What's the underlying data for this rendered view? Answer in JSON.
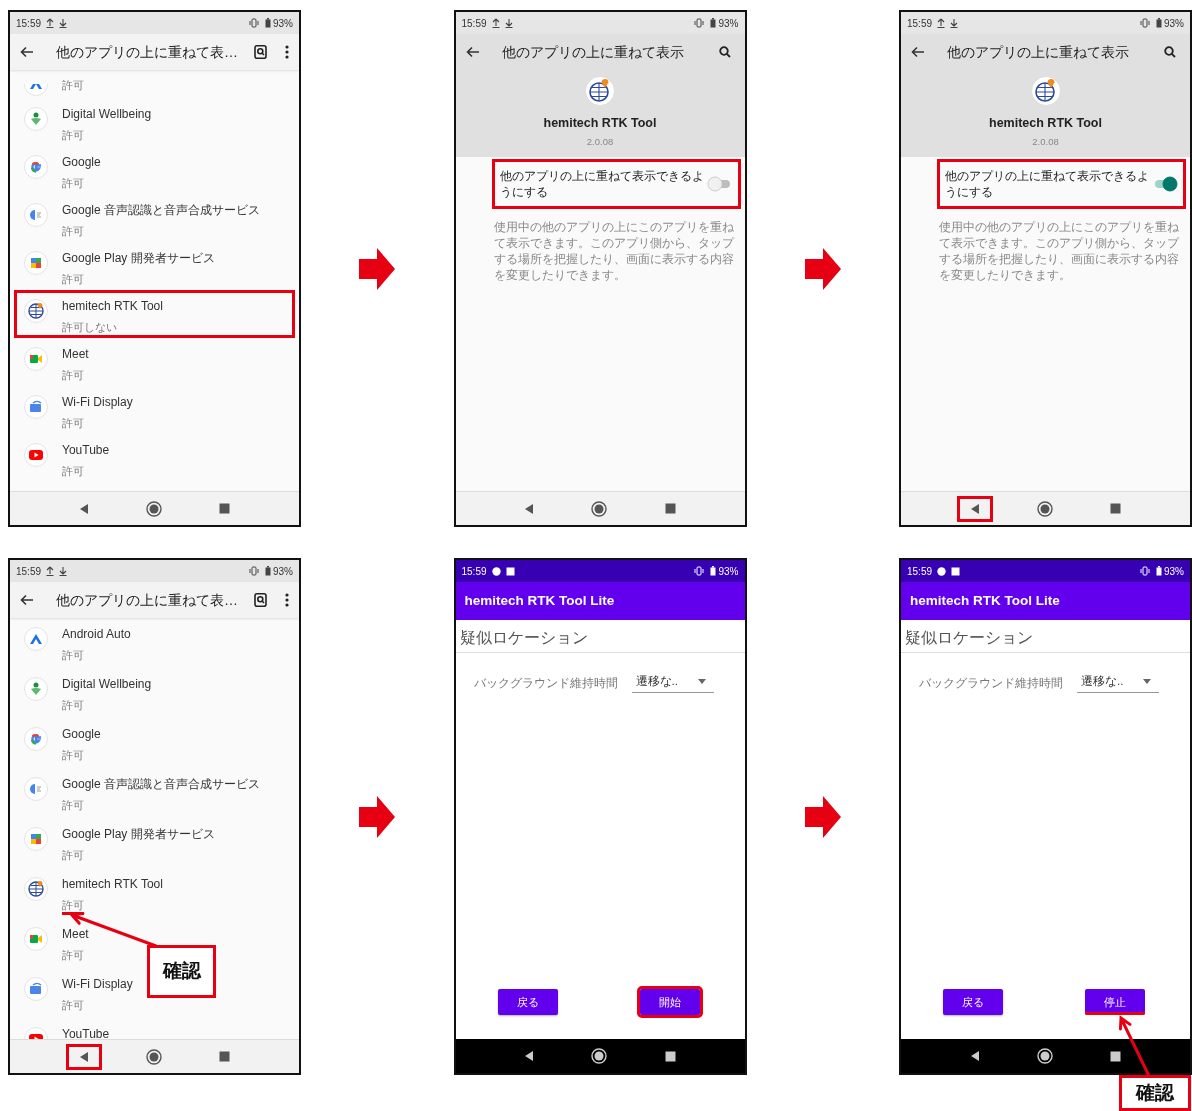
{
  "panels": [
    {
      "kind": "list",
      "status_bar": {
        "time": "15:59",
        "battery": "93%"
      },
      "title": "他のアプリの上に重ねて表…",
      "back_highlighted": false,
      "items": [
        {
          "status": "許可",
          "highlighted": false,
          "underlined": false
        },
        {
          "name": "Digital Wellbeing",
          "status": "許可",
          "highlighted": false,
          "underlined": false
        },
        {
          "name": "Google",
          "status": "許可",
          "highlighted": false,
          "underlined": false
        },
        {
          "name": "Google 音声認識と音声合成サービス",
          "status": "許可",
          "highlighted": false,
          "underlined": false
        },
        {
          "name": "Google Play 開発者サービス",
          "status": "許可",
          "highlighted": false,
          "underlined": false
        },
        {
          "name": "hemitech RTK Tool",
          "status": "許可しない",
          "highlighted": true,
          "underlined": false
        },
        {
          "name": "Meet",
          "status": "許可",
          "highlighted": false,
          "underlined": false
        },
        {
          "name": "Wi-Fi Display",
          "status": "許可",
          "highlighted": false,
          "underlined": false
        },
        {
          "name": "YouTube",
          "status": "許可",
          "highlighted": false,
          "underlined": false
        }
      ]
    },
    {
      "kind": "detail",
      "status_bar": {
        "time": "15:59",
        "battery": "93%"
      },
      "title": "他のアプリの上に重ねて表示",
      "back_highlighted": false,
      "app_name": "hemitech RTK Tool",
      "version": "2.0.08",
      "toggle": {
        "label": "他のアプリの上に重ねて表示できるようにする",
        "on": false,
        "highlighted": true
      },
      "description": "使用中の他のアプリの上にこのアプリを重ねて表示できます。このアプリ側から、タップする場所を把握したり、画面に表示する内容を変更したりできます。"
    },
    {
      "kind": "detail",
      "status_bar": {
        "time": "15:59",
        "battery": "93%"
      },
      "title": "他のアプリの上に重ねて表示",
      "back_highlighted": true,
      "app_name": "hemitech RTK Tool",
      "version": "2.0.08",
      "toggle": {
        "label": "他のアプリの上に重ねて表示できるようにする",
        "on": true,
        "highlighted": true
      },
      "description": "使用中の他のアプリの上にこのアプリを重ねて表示できます。このアプリ側から、タップする場所を把握したり、画面に表示する内容を変更したりできます。"
    },
    {
      "kind": "list",
      "status_bar": {
        "time": "15:59",
        "battery": "93%"
      },
      "title": "他のアプリの上に重ねて表…",
      "back_highlighted": true,
      "callout": {
        "text": "確認"
      },
      "items": [
        {
          "name": "Android Auto",
          "status": "許可",
          "highlighted": false,
          "underlined": false
        },
        {
          "name": "Digital Wellbeing",
          "status": "許可",
          "highlighted": false,
          "underlined": false
        },
        {
          "name": "Google",
          "status": "許可",
          "highlighted": false,
          "underlined": false
        },
        {
          "name": "Google 音声認識と音声合成サービス",
          "status": "許可",
          "highlighted": false,
          "underlined": false
        },
        {
          "name": "Google Play 開発者サービス",
          "status": "許可",
          "highlighted": false,
          "underlined": false
        },
        {
          "name": "hemitech RTK Tool",
          "status": "許可",
          "highlighted": false,
          "underlined": true
        },
        {
          "name": "Meet",
          "status": "許可",
          "highlighted": false,
          "underlined": false
        },
        {
          "name": "Wi-Fi Display",
          "status": "許可",
          "highlighted": false,
          "underlined": false
        },
        {
          "name": "YouTube",
          "highlighted": false,
          "underlined": false
        }
      ]
    },
    {
      "kind": "app",
      "status_bar": {
        "time": "15:59",
        "battery": "93%"
      },
      "back_highlighted": false,
      "app_title": "hemitech RTK Tool Lite",
      "heading": "疑似ロケーション",
      "setting_label": "バックグラウンド維持時間",
      "dropdown_value": "遷移な..",
      "buttons": [
        {
          "label": "戻る",
          "highlighted": false,
          "underlined": false
        },
        {
          "label": "開始",
          "highlighted": true,
          "underlined": false
        }
      ]
    },
    {
      "kind": "app",
      "status_bar": {
        "time": "15:59",
        "battery": "93%"
      },
      "back_highlighted": false,
      "app_title": "hemitech RTK Tool Lite",
      "heading": "疑似ロケーション",
      "setting_label": "バックグラウンド維持時間",
      "dropdown_value": "遷移な..",
      "callout": {
        "text": "確認"
      },
      "buttons": [
        {
          "label": "戻る",
          "highlighted": false,
          "underlined": false
        },
        {
          "label": "停止",
          "highlighted": false,
          "underlined": true
        }
      ]
    }
  ]
}
